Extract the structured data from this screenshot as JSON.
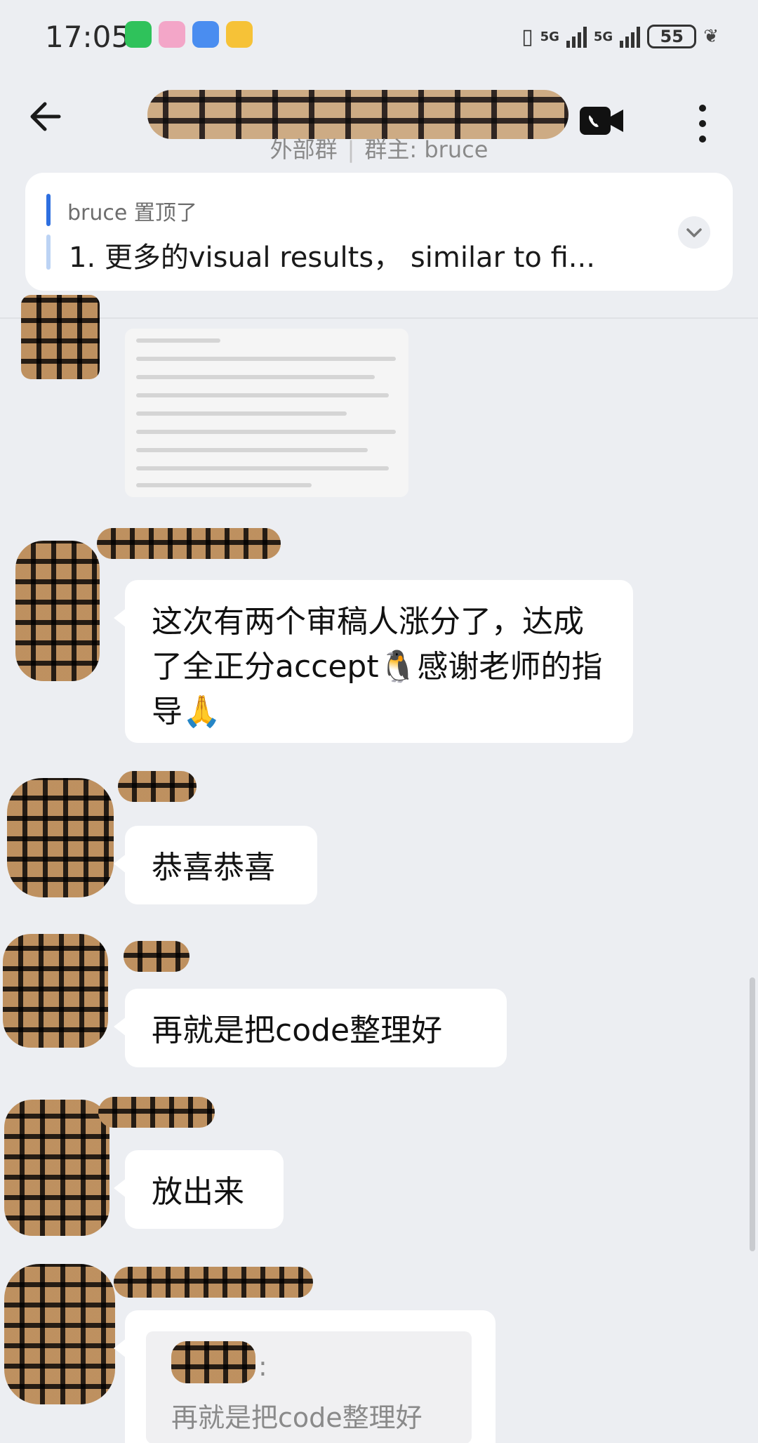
{
  "status_bar": {
    "time": "17:05",
    "network_1": "5G",
    "network_2": "5G",
    "battery": "55"
  },
  "header": {
    "subtitle_group_type": "外部群",
    "subtitle_owner": "群主: bruce"
  },
  "pinned": {
    "author": "bruce 置顶了",
    "text": "1. 更多的visual results， similar to fi..."
  },
  "messages": [
    {
      "type": "image"
    },
    {
      "type": "text",
      "text": "这次有两个审稿人涨分了，达成了全正分accept🐧感谢老师的指导🙏"
    },
    {
      "type": "text",
      "text": "恭喜恭喜"
    },
    {
      "type": "text",
      "text": "再就是把code整理好"
    },
    {
      "type": "text",
      "text": "放出来"
    },
    {
      "type": "quote",
      "colon": ":",
      "quoted_text": "再就是把code整理好"
    }
  ],
  "colors": {
    "background": "#eceef2",
    "bubble": "#ffffff",
    "accent": "#2e6fe0"
  }
}
